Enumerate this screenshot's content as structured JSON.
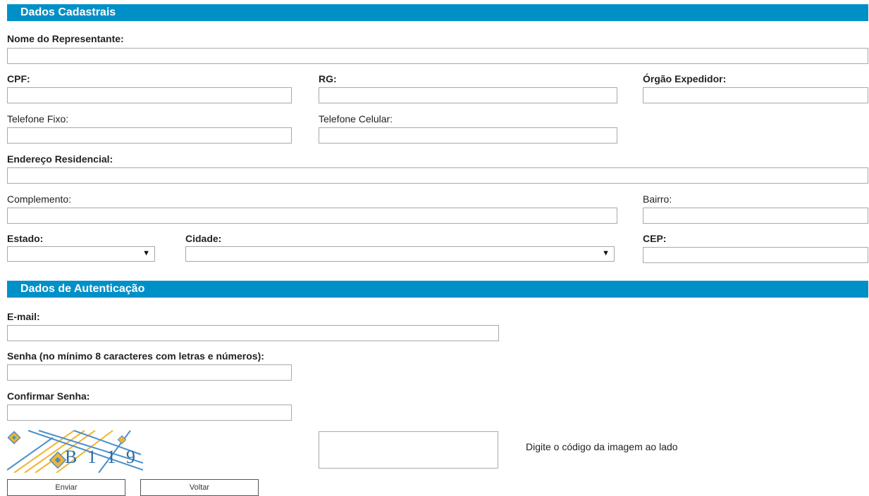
{
  "sections": {
    "cadastrais": "Dados Cadastrais",
    "autenticacao": "Dados de Autenticação"
  },
  "labels": {
    "nome": "Nome do Representante:",
    "cpf": "CPF:",
    "rg": "RG:",
    "orgao": "Órgão Expedidor:",
    "tel_fixo": "Telefone Fixo:",
    "tel_cel": "Telefone Celular:",
    "endereco": "Endereço Residencial:",
    "complemento": "Complemento:",
    "bairro": "Bairro:",
    "estado": "Estado:",
    "cidade": "Cidade:",
    "cep": "CEP:",
    "email": "E-mail:",
    "senha": "Senha (no mínimo 8 caracteres com letras e números):",
    "confirmar": "Confirmar Senha:",
    "captcha_hint": "Digite o código da imagem ao lado"
  },
  "fields": {
    "nome": "",
    "cpf": "",
    "rg": "",
    "orgao": "",
    "tel_fixo": "",
    "tel_cel": "",
    "endereco": "",
    "complemento": "",
    "bairro": "",
    "estado": "",
    "cidade": "",
    "cep": "",
    "email": "",
    "senha": "",
    "confirmar": "",
    "captcha_code": ""
  },
  "captcha": {
    "text": "B 1 1 9"
  },
  "buttons": {
    "enviar": "Enviar",
    "voltar": "Voltar"
  },
  "icons": {
    "select_arrow": "▼"
  },
  "colors": {
    "section_bar": "#0090c8"
  }
}
